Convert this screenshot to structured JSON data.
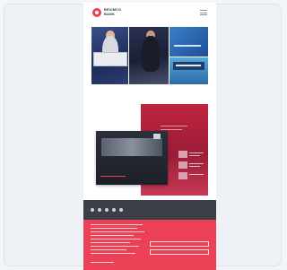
{
  "header": {
    "logo_text": "BEXIMCO BANK",
    "menu_icon": "hamburger-menu-icon"
  },
  "hero": {
    "tiles": [
      "cheque-handover-photo",
      "speaker-photo",
      "news-banner-photo",
      "event-signage-photo"
    ]
  },
  "feature": {
    "heading": "",
    "video_caption": ""
  },
  "footer": {
    "social_icons": [
      "facebook-icon",
      "twitter-icon",
      "linkedin-icon",
      "youtube-icon",
      "instagram-icon"
    ]
  },
  "colors": {
    "brand_red": "#ec4057",
    "dark_band": "#3a3f48",
    "panel_red": "#c0243f"
  }
}
